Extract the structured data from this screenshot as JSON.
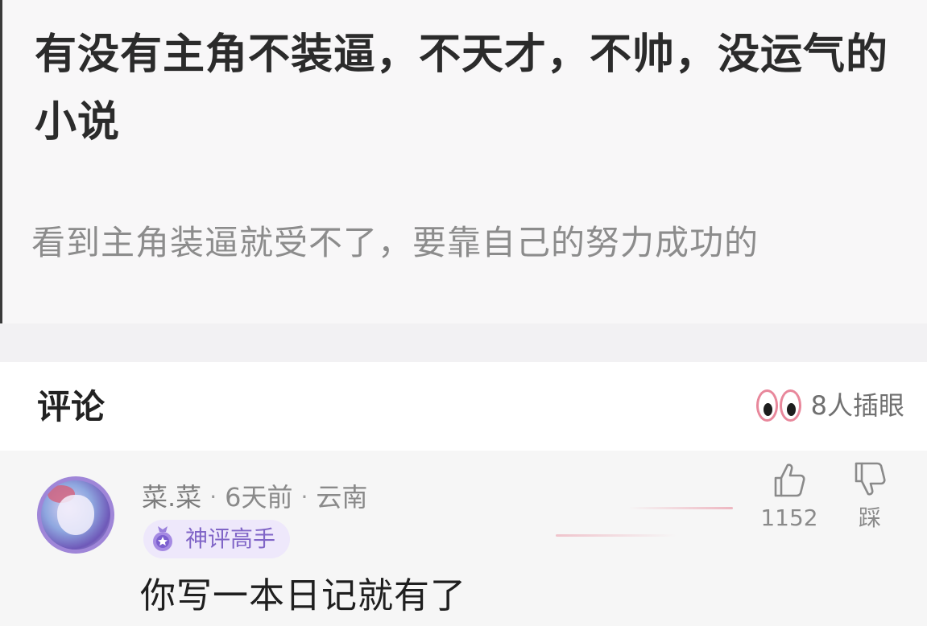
{
  "question": {
    "title": "有没有主角不装逼，不天才，不帅，没运气的小说",
    "description": "看到主角装逼就受不了，要靠自己的努力成功的"
  },
  "comments_section": {
    "title": "评论",
    "peek_label": "8人插眼",
    "peek_icon": "peeking-eyes-icon"
  },
  "comment": {
    "username": "菜.菜",
    "separator": "·",
    "time": "6天前",
    "location": "云南",
    "badge_label": "神评高手",
    "badge_icon": "medal-icon",
    "text": "你写一本日记就有了",
    "like_count": "1152",
    "dislike_label": "踩",
    "like_icon": "thumbs-up-icon",
    "dislike_icon": "thumbs-down-icon"
  },
  "colors": {
    "accent_purple": "#8065c7",
    "badge_bg": "#eee8fb",
    "eye_pink": "#e8879b"
  }
}
